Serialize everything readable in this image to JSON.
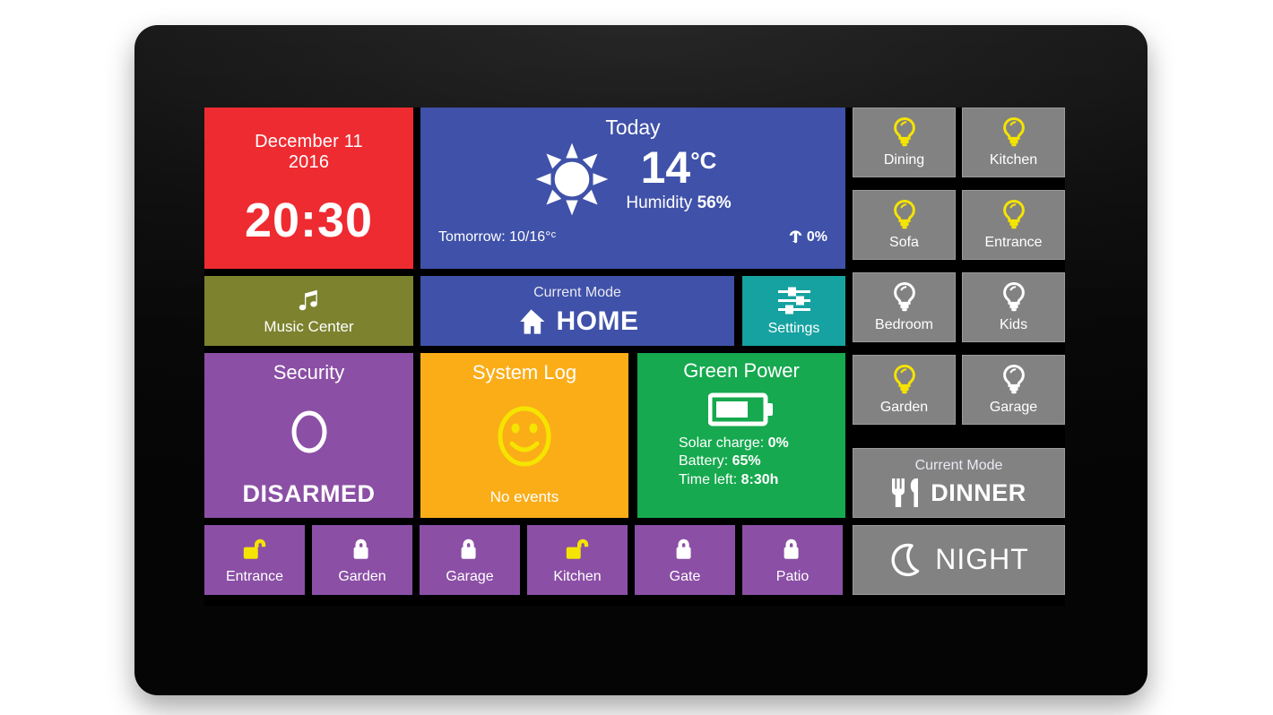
{
  "clock": {
    "date_line1": "December 11",
    "date_line2": "2016",
    "time": "20:30"
  },
  "weather": {
    "title": "Today",
    "temperature": "14",
    "temp_unit": "°C",
    "humidity_label": "Humidity",
    "humidity_value": "56%",
    "tomorrow": "Tomorrow: 10/16°ᶜ",
    "rain_chance": "0%",
    "condition_icon": "sun-icon"
  },
  "music": {
    "label": "Music Center",
    "icon": "music-note-icon"
  },
  "mode_home": {
    "caption": "Current Mode",
    "value": "HOME",
    "icon": "house-icon"
  },
  "settings": {
    "label": "Settings",
    "icon": "sliders-icon"
  },
  "security": {
    "title": "Security",
    "state": "DISARMED",
    "icon": "disarmed-circle-icon"
  },
  "system_log": {
    "title": "System Log",
    "status": "No events",
    "icon": "smiley-face-icon"
  },
  "green_power": {
    "title": "Green Power",
    "icon": "battery-icon",
    "solar_label": "Solar charge:",
    "solar_value": "0%",
    "battery_label": "Battery:",
    "battery_value": "65%",
    "time_left_label": "Time left:",
    "time_left_value": "8:30h"
  },
  "locks": [
    {
      "label": "Entrance",
      "state": "unlocked"
    },
    {
      "label": "Garden",
      "state": "locked"
    },
    {
      "label": "Garage",
      "state": "locked"
    },
    {
      "label": "Kitchen",
      "state": "unlocked"
    },
    {
      "label": "Gate",
      "state": "locked"
    },
    {
      "label": "Patio",
      "state": "locked"
    }
  ],
  "lights": [
    {
      "label": "Dining",
      "state": "on"
    },
    {
      "label": "Kitchen",
      "state": "on"
    },
    {
      "label": "Sofa",
      "state": "on"
    },
    {
      "label": "Entrance",
      "state": "on"
    },
    {
      "label": "Bedroom",
      "state": "off"
    },
    {
      "label": "Kids",
      "state": "off"
    },
    {
      "label": "Garden",
      "state": "on"
    },
    {
      "label": "Garage",
      "state": "off"
    }
  ],
  "mode_dinner": {
    "caption": "Current Mode",
    "value": "DINNER",
    "icon": "cutlery-icon"
  },
  "night": {
    "label": "NIGHT",
    "icon": "moon-icon"
  },
  "colors": {
    "red": "#ee2b31",
    "blue": "#3f51a8",
    "olive": "#7c822e",
    "teal": "#16a2a0",
    "purple": "#8b4fa5",
    "orange": "#fbad18",
    "green": "#16a94f",
    "grey": "#828282",
    "on_yellow": "#f5e400",
    "off_white": "#ffffff",
    "bezel": "#0b0b0b"
  }
}
